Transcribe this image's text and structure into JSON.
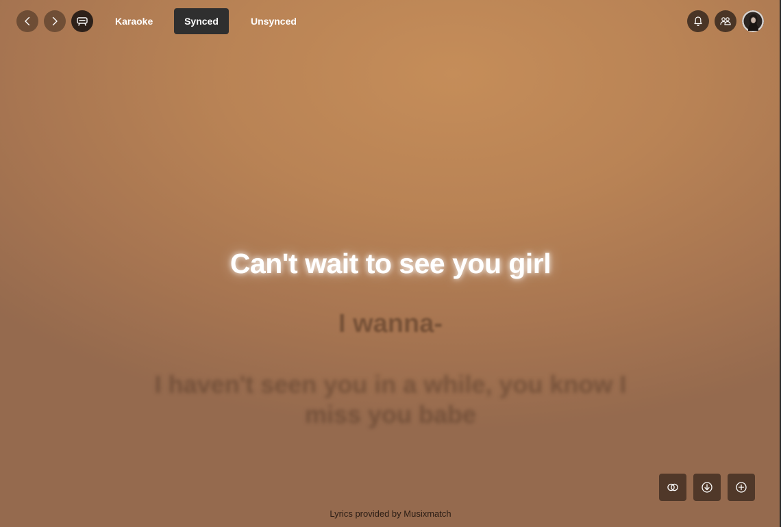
{
  "nav": {
    "back_icon": "chevron-left-icon",
    "forward_icon": "chevron-right-icon",
    "mode_icon": "karaoke-mode-icon"
  },
  "tabs": [
    {
      "label": "Karaoke",
      "active": false
    },
    {
      "label": "Synced",
      "active": true
    },
    {
      "label": "Unsynced",
      "active": false
    }
  ],
  "header_right": {
    "notifications_icon": "bell-icon",
    "friends_icon": "friends-activity-icon",
    "avatar": "user-avatar"
  },
  "lyrics": {
    "current": "Can't wait to see you girl",
    "next": "I wanna-",
    "upcoming": "I haven't seen you in a while, you know I miss you babe"
  },
  "actions": {
    "translate_icon": "dual-lyrics-icon",
    "download_icon": "download-circle-icon",
    "add_icon": "plus-circle-icon"
  },
  "footer": {
    "credit": "Lyrics provided by Musixmatch"
  },
  "colors": {
    "background_top": "#c58d59",
    "background_bottom": "#956a4e",
    "active_tab": "#2f2f2f",
    "action_button": "#503829"
  }
}
